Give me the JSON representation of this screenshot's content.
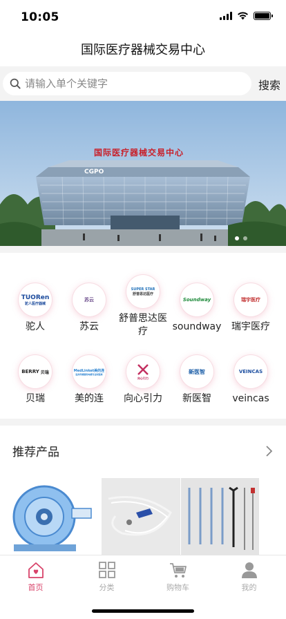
{
  "status_bar": {
    "time": "10:05",
    "icons": [
      "signal-icon",
      "wifi-icon",
      "battery-icon"
    ]
  },
  "header": {
    "title": "国际医疗器械交易中心"
  },
  "search": {
    "placeholder": "请输入单个关键字",
    "value": "",
    "button_label": "搜索"
  },
  "banner": {
    "sign_text": "国际医疗器械交易中心",
    "building_logo": "CGPO",
    "slide_count": 2,
    "active_slide": 1
  },
  "brands": [
    {
      "name": "驼人",
      "logo_text": "TUORen",
      "logo_sub": "驼人医疗器械"
    },
    {
      "name": "苏云",
      "logo_text": "苏云",
      "logo_sub": ""
    },
    {
      "name": "舒普思达医疗",
      "logo_text": "SUPER STAR",
      "logo_sub": "舒普思达医疗"
    },
    {
      "name": "soundway",
      "logo_text": "Soundway",
      "logo_sub": ""
    },
    {
      "name": "瑞宇医疗",
      "logo_text": "瑞宇医疗",
      "logo_sub": ""
    },
    {
      "name": "贝瑞",
      "logo_text": "BERRY",
      "logo_sub": "贝瑞"
    },
    {
      "name": "美的连",
      "logo_text": "MedLinket美的连",
      "logo_sub": "医用传感器和电缆专业制造商"
    },
    {
      "name": "向心引力",
      "logo_text": "向心引力",
      "logo_sub": ""
    },
    {
      "name": "新医智",
      "logo_text": "新医智",
      "logo_sub": ""
    },
    {
      "name": "veincas",
      "logo_text": "VEINCAS",
      "logo_sub": ""
    }
  ],
  "recommend": {
    "title": "推荐产品",
    "chevron_icon": "chevron-right-icon"
  },
  "tab_bar": {
    "active_index": 0,
    "active_color": "#d8436a",
    "items": [
      {
        "label": "首页",
        "icon": "home-icon"
      },
      {
        "label": "分类",
        "icon": "grid-icon"
      },
      {
        "label": "购物车",
        "icon": "cart-icon"
      },
      {
        "label": "我的",
        "icon": "user-icon"
      }
    ]
  }
}
